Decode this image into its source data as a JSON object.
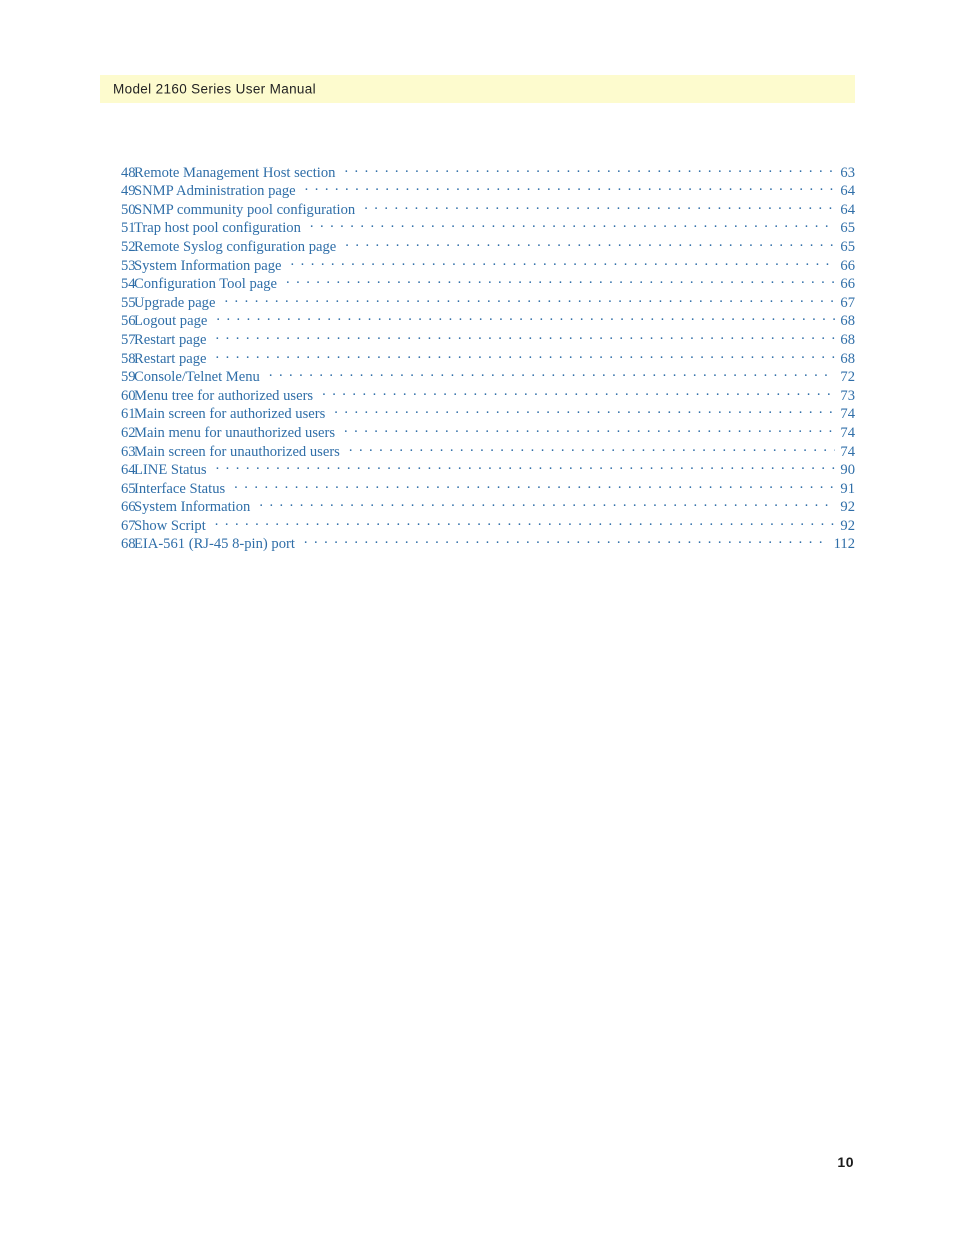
{
  "header": {
    "title": "Model 2160 Series User Manual",
    "band_color": "#fdfbce",
    "text_color": "#232323"
  },
  "toc": {
    "accent_color": "#2f6ea8",
    "entries": [
      {
        "num": "48",
        "title": "Remote Management Host section",
        "page": "63"
      },
      {
        "num": "49",
        "title": "SNMP Administration page",
        "page": "64"
      },
      {
        "num": "50",
        "title": "SNMP community pool configuration",
        "page": "64"
      },
      {
        "num": "51",
        "title": "Trap host pool configuration",
        "page": "65"
      },
      {
        "num": "52",
        "title": "Remote Syslog configuration page",
        "page": "65"
      },
      {
        "num": "53",
        "title": "System Information page",
        "page": "66"
      },
      {
        "num": "54",
        "title": "Configuration Tool page",
        "page": "66"
      },
      {
        "num": "55",
        "title": "Upgrade page",
        "page": "67"
      },
      {
        "num": "56",
        "title": "Logout page",
        "page": "68"
      },
      {
        "num": "57",
        "title": "Restart page",
        "page": "68"
      },
      {
        "num": "58",
        "title": "Restart page",
        "page": "68"
      },
      {
        "num": "59",
        "title": "Console/Telnet Menu",
        "page": "72"
      },
      {
        "num": "60",
        "title": "Menu tree for authorized users",
        "page": "73"
      },
      {
        "num": "61",
        "title": "Main screen for authorized users",
        "page": "74"
      },
      {
        "num": "62",
        "title": "Main menu for unauthorized users",
        "page": "74"
      },
      {
        "num": "63",
        "title": "Main screen for unauthorized users",
        "page": "74"
      },
      {
        "num": "64",
        "title": "LINE Status",
        "page": "90"
      },
      {
        "num": "65",
        "title": "Interface Status",
        "page": "91"
      },
      {
        "num": "66",
        "title": "System Information",
        "page": "92"
      },
      {
        "num": "67",
        "title": "Show Script",
        "page": "92"
      },
      {
        "num": "68",
        "title": "EIA-561 (RJ-45 8-pin) port",
        "page": "112"
      }
    ]
  },
  "footer": {
    "page_number": "10"
  }
}
